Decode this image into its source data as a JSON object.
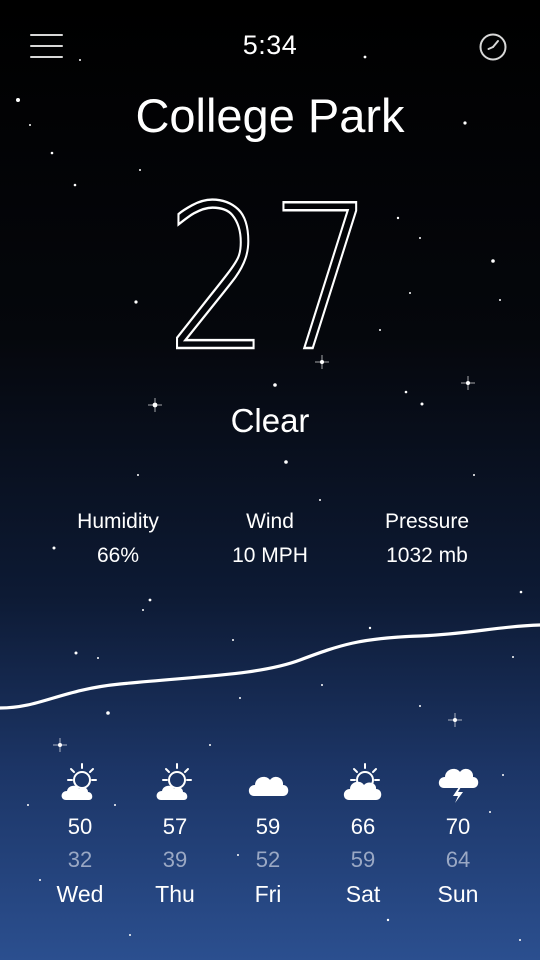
{
  "status_bar": {
    "time": "5:34"
  },
  "header": {
    "menu_icon": "hamburger-menu-icon",
    "clock_icon": "clock-icon"
  },
  "current": {
    "city": "College Park",
    "temperature": "27",
    "condition": "Clear"
  },
  "stats": [
    {
      "label": "Humidity",
      "value": "66%"
    },
    {
      "label": "Wind",
      "value": "10 MPH"
    },
    {
      "label": "Pressure",
      "value": "1032 mb"
    }
  ],
  "forecast": [
    {
      "day": "Wed",
      "high": "50",
      "low": "32",
      "icon": "sun-cloud-icon"
    },
    {
      "day": "Thu",
      "high": "57",
      "low": "39",
      "icon": "sun-cloud-icon"
    },
    {
      "day": "Fri",
      "high": "59",
      "low": "52",
      "icon": "cloud-icon"
    },
    {
      "day": "Sat",
      "high": "66",
      "low": "59",
      "icon": "sun-cloud-icon"
    },
    {
      "day": "Sun",
      "high": "70",
      "low": "64",
      "icon": "thunderstorm-icon"
    }
  ],
  "colors": {
    "background_top": "#000000",
    "background_bottom": "#2b4f8f",
    "low_temp": "#9aa8c4"
  }
}
